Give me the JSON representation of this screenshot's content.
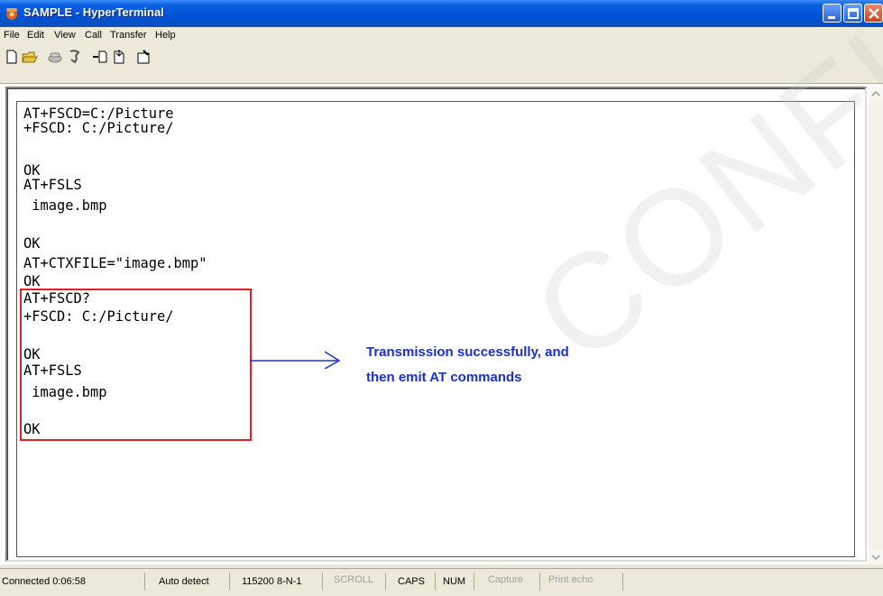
{
  "window": {
    "title": "SAMPLE - HyperTerminal",
    "app_icon": "hyperterminal-phone-icon"
  },
  "menu": {
    "items": [
      "File",
      "Edit",
      "View",
      "Call",
      "Transfer",
      "Help"
    ]
  },
  "toolbar": {
    "icons": [
      "new-icon",
      "open-icon",
      "connect-icon",
      "disconnect-icon",
      "send-icon",
      "receive-icon",
      "properties-icon"
    ]
  },
  "terminal": {
    "lines": [
      "AT+FSCD=C:/Picture",
      "+FSCD: C:/Picture/",
      "",
      "OK",
      "AT+FSLS",
      " image.bmp",
      "",
      "OK",
      "AT+CTXFILE=\"image.bmp\"",
      "OK",
      "AT+FSCD?",
      "+FSCD: C:/Picture/",
      "",
      "OK",
      "AT+FSLS",
      " image.bmp",
      "",
      "OK"
    ]
  },
  "annotation": {
    "line1": "Transmission successfully, and",
    "line2": "then emit AT commands",
    "color": "#1a2fd6",
    "box_color": "#e3202a"
  },
  "watermark": {
    "text": "CONFIDENTIAL"
  },
  "statusbar": {
    "connected": "Connected 0:06:58",
    "detect": "Auto detect",
    "settings": "115200 8-N-1",
    "scroll": "SCROLL",
    "caps": "CAPS",
    "num": "NUM",
    "capture": "Capture",
    "print_echo": "Print echo"
  }
}
